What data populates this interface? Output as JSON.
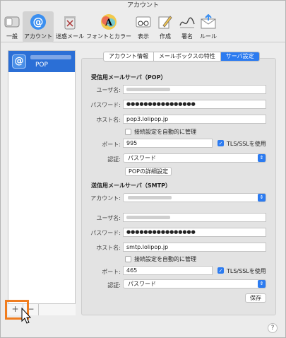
{
  "window": {
    "title": "アカウント"
  },
  "toolbar": {
    "items": [
      {
        "label": "一般",
        "icon": "switch-icon"
      },
      {
        "label": "アカウント",
        "icon": "at-sign-icon"
      },
      {
        "label": "迷惑メール",
        "icon": "junk-trash-icon"
      },
      {
        "label": "フォントとカラー",
        "icon": "font-color-icon"
      },
      {
        "label": "表示",
        "icon": "glasses-icon"
      },
      {
        "label": "作成",
        "icon": "compose-pencil-icon"
      },
      {
        "label": "署名",
        "icon": "signature-icon"
      },
      {
        "label": "ルール",
        "icon": "rules-envelope-icon"
      }
    ]
  },
  "accounts": {
    "selected": {
      "name": "",
      "type": "POP"
    },
    "add_button": "+",
    "remove_button": "−"
  },
  "tabs": [
    "アカウント情報",
    "メールボックスの特性",
    "サーバ設定"
  ],
  "incoming": {
    "title": "受信用メールサーバ（POP）",
    "username_label": "ユーザ名:",
    "password_label": "パスワード:",
    "password_value": "●●●●●●●●●●●●●●●●",
    "host_label": "ホスト名:",
    "host_value": "pop3.lolipop.jp",
    "auto_manage_label": "接続設定を自動的に管理",
    "port_label": "ポート:",
    "port_value": "995",
    "tls_label": "TLS/SSLを使用",
    "auth_label": "認証:",
    "auth_value": "パスワード",
    "advanced_button": "POPの詳細設定"
  },
  "outgoing": {
    "title": "送信用メールサーバ（SMTP）",
    "account_label": "アカウント:",
    "username_label": "ユーザ名:",
    "password_label": "パスワード:",
    "password_value": "●●●●●●●●●●●●●●●●",
    "host_label": "ホスト名:",
    "host_value": "smtp.lolipop.jp",
    "auto_manage_label": "接続設定を自動的に管理",
    "port_label": "ポート:",
    "port_value": "465",
    "tls_label": "TLS/SSLを使用",
    "auth_label": "認証:",
    "auth_value": "パスワード"
  },
  "save_button": "保存",
  "help_button": "?",
  "colors": {
    "accent": "#2c7bf0",
    "highlight": "#f07d1f",
    "selection": "#2b6fd6"
  }
}
